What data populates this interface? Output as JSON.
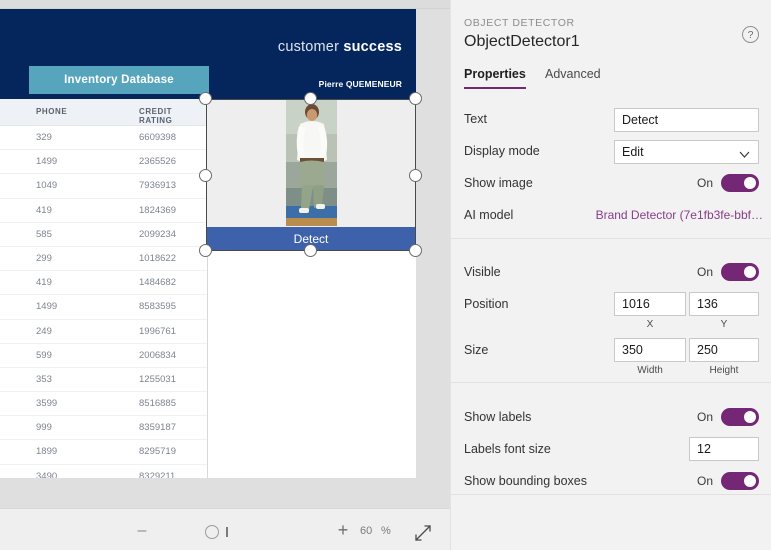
{
  "app_preview": {
    "header": {
      "brand_prefix": "customer ",
      "brand_bold": "success",
      "user_name": "Pierre QUEMENEUR",
      "nav_button": "Inventory Database"
    },
    "gallery": {
      "columns": [
        "PHONE",
        "CREDIT RATING"
      ],
      "rows": [
        [
          "329",
          "6609398"
        ],
        [
          "1499",
          "2365526"
        ],
        [
          "1049",
          "7936913"
        ],
        [
          "419",
          "1824369"
        ],
        [
          "585",
          "2099234"
        ],
        [
          "299",
          "1018622"
        ],
        [
          "419",
          "1484682"
        ],
        [
          "1499",
          "8583595"
        ],
        [
          "249",
          "1996761"
        ],
        [
          "599",
          "2006834"
        ],
        [
          "353",
          "1255031"
        ],
        [
          "3599",
          "8516885"
        ],
        [
          "999",
          "8359187"
        ],
        [
          "1899",
          "8295719"
        ],
        [
          "3490",
          "8329211"
        ]
      ]
    },
    "object_detector": {
      "button_label": "Detect"
    }
  },
  "bottom_toolbar": {
    "zoom_out": "–",
    "zoom_in": "+",
    "zoom_value": "60",
    "zoom_unit": "%"
  },
  "properties_panel": {
    "kicker": "OBJECT DETECTOR",
    "title": "ObjectDetector1",
    "help": "?",
    "tabs": [
      {
        "label": "Properties",
        "selected": true
      },
      {
        "label": "Advanced",
        "selected": false
      }
    ],
    "accent_color": "#742774",
    "link_color": "#8a3d8a",
    "section1": {
      "text_label": "Text",
      "text_value": "Detect",
      "display_mode_label": "Display mode",
      "display_mode_value": "Edit",
      "show_image_label": "Show image",
      "show_image_state": "On",
      "ai_model_label": "AI model",
      "ai_model_value": "Brand Detector (7e1fb3fe-bbf…"
    },
    "section2": {
      "visible_label": "Visible",
      "visible_state": "On",
      "position_label": "Position",
      "position_x": "1016",
      "position_y": "136",
      "position_x_sub": "X",
      "position_y_sub": "Y",
      "size_label": "Size",
      "size_width": "350",
      "size_height": "250",
      "size_width_sub": "Width",
      "size_height_sub": "Height"
    },
    "section3": {
      "show_labels_label": "Show labels",
      "show_labels_state": "On",
      "labels_font_size_label": "Labels font size",
      "labels_font_size_value": "12",
      "show_boxes_label": "Show bounding boxes",
      "show_boxes_state": "On"
    }
  }
}
